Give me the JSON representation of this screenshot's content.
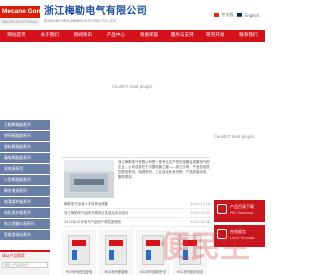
{
  "header": {
    "logo_text": "Mecane Gonso",
    "logo_sub": "MAILEN ELECTRICAL",
    "company_cn": "浙江梅勒电气有限公司",
    "company_en": "ZHEJIANG MEILANDEN ELECTRIC CO.,LTD",
    "lang_cn": "中文版",
    "lang_en": "English"
  },
  "nav": {
    "items": [
      "网站首页",
      "关于我们",
      "新闻资讯",
      "产品中心",
      "资质荣誉",
      "服务与支持",
      "研究开发",
      "联系我们"
    ]
  },
  "banner": {
    "message": "Couldn't load plugin."
  },
  "sidebar": {
    "categories": [
      "万能断路器系列",
      "塑壳断路器系列",
      "塑料断路器系列",
      "漏电断路器系列",
      "双电源系列",
      "小型断路器系列",
      "剩余电流系列",
      "电涌保护器系列",
      "电机保护器系列",
      "电力测量仪表系列",
      "智能型电动系列"
    ],
    "search_title": "请从产品搜索",
    "search_placeholder": "请输入产品关键字"
  },
  "news": {
    "intro": "浙江梅勒电气有限公司是一家专业生产低压电器及成套电气的企业，公司总部位于中国电器之都——浙江乐清，产品包括低压配电系列、电源系列、工业自动化系列等，产品质量优良，服务周到。",
    "items": [
      {
        "title": "梅勒电气加强人才培养及储备",
        "date": "2014-11-18"
      },
      {
        "title": "浙江梅勒电气组织开展岗位技能及安全培训",
        "date": "2014-11-05"
      },
      {
        "title": "2014年10月电气产品用户满意度调查",
        "date": "2014-10-26"
      }
    ]
  },
  "products": [
    {
      "caption": "MC9系列低压配电"
    },
    {
      "caption": "MCB系列断路器"
    },
    {
      "caption": "MCE系列漏电开关"
    },
    {
      "caption": "MCL系列剩余电流"
    }
  ],
  "right": {
    "message": "Couldn't load plugin.",
    "boxes": [
      {
        "title": "产品目录下载",
        "sub": "PDF Download"
      },
      {
        "title": "在线留言",
        "sub": "Leave Message"
      }
    ]
  },
  "watermark": "便民生"
}
